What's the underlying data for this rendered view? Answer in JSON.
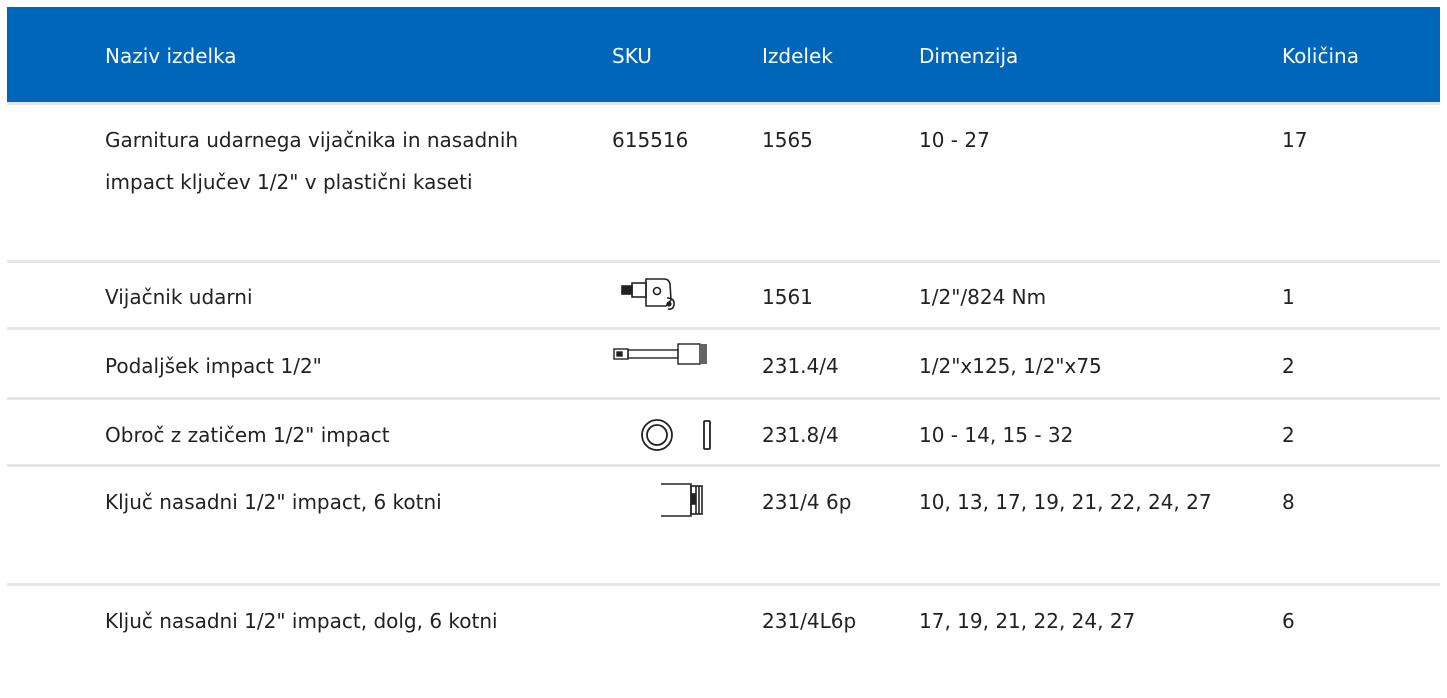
{
  "table": {
    "headers": {
      "name": "Naziv izdelka",
      "sku": "SKU",
      "item": "Izdelek",
      "dimension": "Dimenzija",
      "quantity": "Količina"
    },
    "rows": [
      {
        "name": "Garnitura udarnega vijačnika in nasadnih impact ključev 1/2\" v plastični kaseti",
        "sku": "615516",
        "sku_icon": "",
        "item": "1565",
        "dimension": "10 - 27",
        "quantity": "17"
      },
      {
        "name": "Vijačnik udarni",
        "sku": "",
        "sku_icon": "impact-wrench-icon",
        "item": "1561",
        "dimension": "1/2\"/824 Nm",
        "quantity": "1"
      },
      {
        "name": "Podaljšek impact 1/2\"",
        "sku": "",
        "sku_icon": "extension-bar-icon",
        "item": "231.4/4",
        "dimension": "1/2\"x125, 1/2\"x75",
        "quantity": "2"
      },
      {
        "name": "Obroč z zatičem 1/2\" impact",
        "sku": "",
        "sku_icon": "ring-and-pin-icon",
        "item": "231.8/4",
        "dimension": "10 - 14, 15 - 32",
        "quantity": "2"
      },
      {
        "name": "Ključ nasadni 1/2\" impact, 6 kotni",
        "sku": "",
        "sku_icon": "socket-icon",
        "item": "231/4 6p",
        "dimension": "10, 13, 17, 19, 21, 22, 24, 27",
        "quantity": "8"
      },
      {
        "name": "Ključ nasadni 1/2\" impact, dolg, 6 kotni",
        "sku": "",
        "sku_icon": "",
        "item": "231/4L6p",
        "dimension": "17, 19, 21, 22, 24, 27",
        "quantity": "6"
      }
    ]
  },
  "colors": {
    "header_bg": "#0066b9",
    "header_text": "#ffffff",
    "row_divider": "#e6e6e6",
    "body_text": "#222222"
  }
}
